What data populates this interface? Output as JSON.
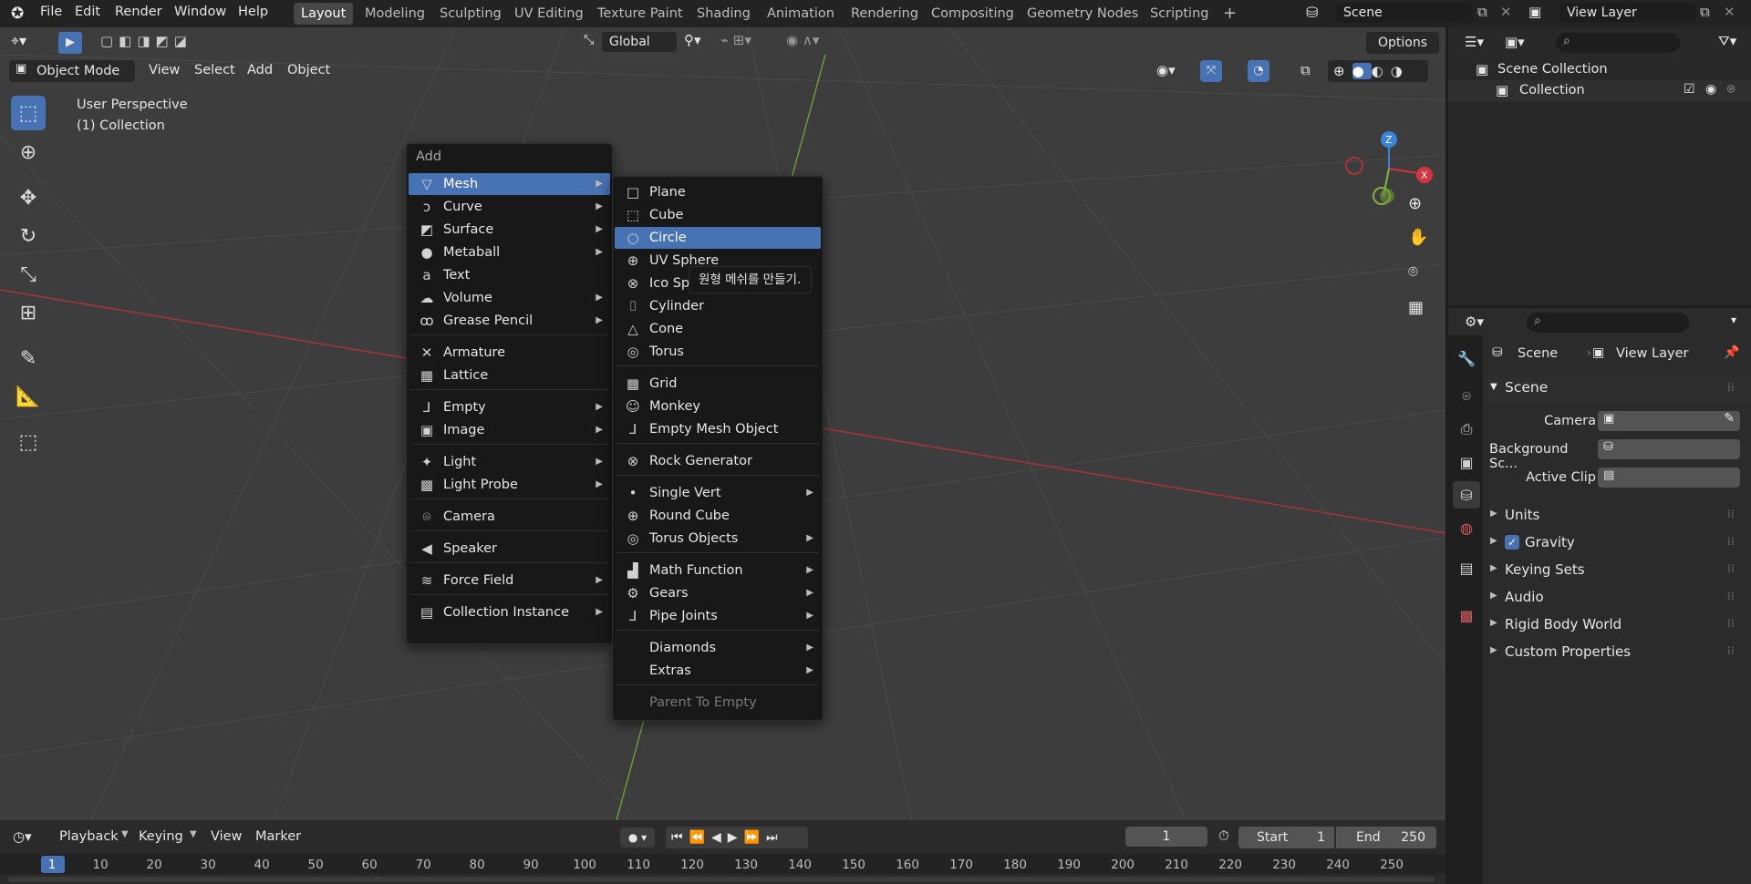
{
  "topbar": {
    "menus": [
      "File",
      "Edit",
      "Render",
      "Window",
      "Help"
    ],
    "workspaces": [
      "Layout",
      "Modeling",
      "Sculpting",
      "UV Editing",
      "Texture Paint",
      "Shading",
      "Animation",
      "Rendering",
      "Compositing",
      "Geometry Nodes",
      "Scripting"
    ],
    "active_workspace": "Layout",
    "add_workspace": "+",
    "scene_value": "Scene",
    "view_layer_value": "View Layer"
  },
  "viewport": {
    "transform_orientation": "Global",
    "options_label": "Options",
    "mode_label": "Object Mode",
    "header_menus": [
      "View",
      "Select",
      "Add",
      "Object"
    ],
    "perspective_text": "User Perspective",
    "collection_text": "(1) Collection",
    "gizmo": {
      "z": "Z",
      "x": "X"
    }
  },
  "add_menu": {
    "title": "Add",
    "items": [
      {
        "label": "Mesh",
        "icon": "mesh-icon",
        "glyph": "▽",
        "submenu": true,
        "highlight": true
      },
      {
        "label": "Curve",
        "icon": "curve-icon",
        "glyph": "ↄ",
        "submenu": true
      },
      {
        "label": "Surface",
        "icon": "surface-icon",
        "glyph": "◩",
        "submenu": true
      },
      {
        "label": "Metaball",
        "icon": "metaball-icon",
        "glyph": "●",
        "submenu": true
      },
      {
        "label": "Text",
        "icon": "text-icon",
        "glyph": "a",
        "submenu": false
      },
      {
        "label": "Volume",
        "icon": "volume-icon",
        "glyph": "☁",
        "submenu": true
      },
      {
        "label": "Grease Pencil",
        "icon": "grease-pencil-icon",
        "glyph": "ꝏ",
        "submenu": true
      },
      {
        "label": "Armature",
        "icon": "armature-icon",
        "glyph": "✕",
        "submenu": false,
        "sep_before": true
      },
      {
        "label": "Lattice",
        "icon": "lattice-icon",
        "glyph": "▦",
        "submenu": false
      },
      {
        "label": "Empty",
        "icon": "empty-icon",
        "glyph": "⅃",
        "submenu": true,
        "sep_before": true
      },
      {
        "label": "Image",
        "icon": "image-icon",
        "glyph": "▣",
        "submenu": true
      },
      {
        "label": "Light",
        "icon": "light-icon",
        "glyph": "✦",
        "submenu": true,
        "sep_before": true
      },
      {
        "label": "Light Probe",
        "icon": "light-probe-icon",
        "glyph": "▩",
        "submenu": true
      },
      {
        "label": "Camera",
        "icon": "camera-icon",
        "glyph": "⌾",
        "submenu": false,
        "sep_before": true
      },
      {
        "label": "Speaker",
        "icon": "speaker-icon",
        "glyph": "◀",
        "submenu": false,
        "sep_before": true
      },
      {
        "label": "Force Field",
        "icon": "force-field-icon",
        "glyph": "≋",
        "submenu": true,
        "sep_before": true
      },
      {
        "label": "Collection Instance",
        "icon": "collection-instance-icon",
        "glyph": "▤",
        "submenu": true,
        "sep_before": true
      }
    ]
  },
  "mesh_menu": {
    "items": [
      {
        "label": "Plane",
        "icon": "plane-icon",
        "glyph": "□"
      },
      {
        "label": "Cube",
        "icon": "cube-icon",
        "glyph": "⬚"
      },
      {
        "label": "Circle",
        "icon": "circle-icon",
        "glyph": "○",
        "highlight": true
      },
      {
        "label": "UV Sphere",
        "icon": "uv-sphere-icon",
        "glyph": "⊕"
      },
      {
        "label": "Ico Sphere",
        "icon": "ico-sphere-icon",
        "glyph": "⊗"
      },
      {
        "label": "Cylinder",
        "icon": "cylinder-icon",
        "glyph": "⌷"
      },
      {
        "label": "Cone",
        "icon": "cone-icon",
        "glyph": "△"
      },
      {
        "label": "Torus",
        "icon": "torus-icon",
        "glyph": "◎"
      },
      {
        "label": "Grid",
        "icon": "grid-icon",
        "glyph": "▦",
        "sep_before": true
      },
      {
        "label": "Monkey",
        "icon": "monkey-icon",
        "glyph": "☺"
      },
      {
        "label": "Empty Mesh Object",
        "icon": "empty-mesh-icon",
        "glyph": "⅃"
      },
      {
        "label": "Rock Generator",
        "icon": "rock-generator-icon",
        "glyph": "⊗",
        "sep_before": true
      },
      {
        "label": "Single Vert",
        "icon": "single-vert-icon",
        "glyph": "•",
        "submenu": true,
        "sep_before": true
      },
      {
        "label": "Round Cube",
        "icon": "round-cube-icon",
        "glyph": "⊕"
      },
      {
        "label": "Torus Objects",
        "icon": "torus-objects-icon",
        "glyph": "◎",
        "submenu": true
      },
      {
        "label": "Math Function",
        "icon": "math-function-icon",
        "glyph": "▟",
        "submenu": true,
        "sep_before": true
      },
      {
        "label": "Gears",
        "icon": "gears-icon",
        "glyph": "⚙",
        "submenu": true
      },
      {
        "label": "Pipe Joints",
        "icon": "pipe-joints-icon",
        "glyph": "⅃",
        "submenu": true
      },
      {
        "label": "Diamonds",
        "icon": "diamonds-icon",
        "glyph": "",
        "submenu": true,
        "sep_before": true
      },
      {
        "label": "Extras",
        "icon": "extras-icon",
        "glyph": "",
        "submenu": true
      },
      {
        "label": "Parent To Empty",
        "icon": "parent-to-empty-icon",
        "glyph": "",
        "disabled": true,
        "sep_before": true
      }
    ]
  },
  "tooltip": "원형 메쉬를 만들기.",
  "timeline": {
    "menus": [
      "Playback",
      "Keying",
      "View",
      "Marker"
    ],
    "current_frame": "1",
    "start_label": "Start",
    "start_value": "1",
    "end_label": "End",
    "end_value": "250",
    "ticks": [
      "1",
      "10",
      "20",
      "30",
      "40",
      "50",
      "60",
      "70",
      "80",
      "90",
      "100",
      "110",
      "120",
      "130",
      "140",
      "150",
      "160",
      "170",
      "180",
      "190",
      "200",
      "210",
      "220",
      "230",
      "240",
      "250"
    ]
  },
  "outliner": {
    "scene_collection": "Scene Collection",
    "collection": "Collection"
  },
  "properties": {
    "breadcrumb_scene": "Scene",
    "breadcrumb_view_layer": "View Layer",
    "section_scene": "Scene",
    "camera_label": "Camera",
    "background_label": "Background Sc...",
    "active_clip_label": "Active Clip",
    "panels": [
      "Units",
      "Gravity",
      "Keying Sets",
      "Audio",
      "Rigid Body World",
      "Custom Properties"
    ],
    "gravity_checked": true
  },
  "colors": {
    "accent": "#4772b3",
    "x_axis": "#d8343f",
    "y_axis": "#82b33c",
    "z_axis": "#3b83d8"
  }
}
